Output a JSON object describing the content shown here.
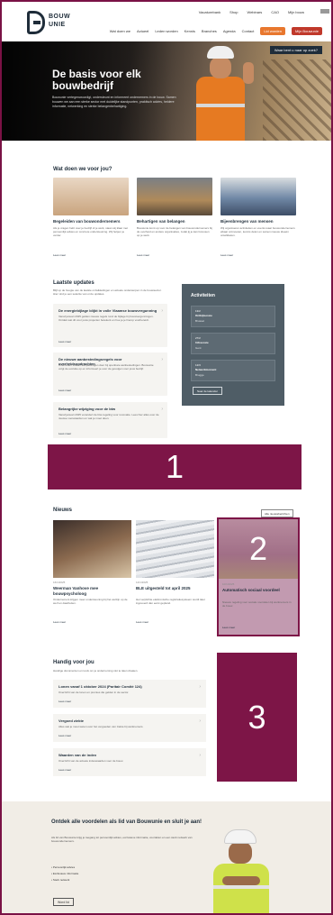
{
  "header": {
    "logo_text_1": "BOUW",
    "logo_text_2": "UNIE",
    "util_nav": [
      "Vacaturebank",
      "Shop",
      "Webinars",
      "CAO",
      "Mijn bouw"
    ],
    "main_nav": [
      "Wat doen we",
      "Actueel",
      "Leden worden",
      "Kennis",
      "Branches",
      "Agenda",
      "Contact"
    ],
    "btn_member": "Lid worden",
    "btn_login": "Mijn Bouwunie",
    "search_label": "Waar bent u naar op zoek?"
  },
  "hero": {
    "title": "De basis voor elk bouwbedrijf",
    "text": "Bouwunie vertegenwoordigt, ondersteunt en informeert ondernemers in de bouw. Samen bouwen we aan een sterke sector met duidelijke standpunten, praktisch advies, heldere informatie, netwerking en sterke belangenbehartiging."
  },
  "services": {
    "title": "Wat doen we voor jou?",
    "items": [
      {
        "title": "Begeleiden van bouwondernemers",
        "text": "Als je vragen hebt over je bedrijf of je werk, staan wij klaar met persoonlijk advies en concrete ondersteuning. Wij helpen je verder.",
        "link": "Lees meer"
      },
      {
        "title": "Behartigen van belangen",
        "text": "Bouwunie komt op voor de belangen van bouwondernemers bij de overheid en andere organisaties, zodat jij je kan focussen op je werk.",
        "link": "Lees meer"
      },
      {
        "title": "Bijeenbrengen van mensen",
        "text": "Wij organiseren activiteiten en events waar bouwondernemers elkaar ontmoeten, kennis delen en samen nieuwe ideeën ontwikkelen.",
        "link": "Lees meer"
      }
    ]
  },
  "updates": {
    "title": "Laatste updates",
    "intro": "Blijf op de hoogte van de laatste ontwikkelingen en actuele onderwerpen in de bouwsector. Hier vind je een selectie van onze updates.",
    "items": [
      {
        "title": "De energiebijlage blijkt in volle Vlaamse bouwvergunning",
        "text": "Vanaf januari 2025 gelden nieuwe regels rond de bijlage bij bouwvergunningen. Ontdek wat dit voor jouw projecten betekent en hoe je je hierop voorbereidt.",
        "link": "Lees meer"
      },
      {
        "title": "De nieuwe aanbestedingsregels voor overheidsopdrachten",
        "text": "Overheden voeren aanpassingen door bij openbare aanbestedingen. Bouwunie volgt de evolutie op en informeert je over de gevolgen voor jouw bedrijf.",
        "link": "Lees meer"
      },
      {
        "title": "Belangrijke wijziging voor de btw",
        "text": "Vanaf januari 2025 verandert de btw-regeling voor renovatie. Lees hier alles over de nieuwe voorwaarden en wat je moet doen.",
        "link": "Lees meer"
      }
    ]
  },
  "activities": {
    "title": "Activiteiten",
    "items": [
      {
        "date": "13/2",
        "name": "Ontbijtsessie",
        "sub": "Brussel"
      },
      {
        "date": "27/2",
        "name": "Infosessie",
        "sub": "Gent"
      },
      {
        "date": "12/3",
        "name": "Netwerkmoment",
        "sub": "Brugge"
      }
    ],
    "button": "Naar de kalender"
  },
  "highlight1": {
    "number": "1"
  },
  "highlight2": {
    "number": "2"
  },
  "highlight3": {
    "number": "3"
  },
  "news": {
    "title": "Nieuws",
    "all_button": "Alle nieuwsberichten",
    "items": [
      {
        "date": "16/1/2025",
        "title": "Weerman Vanhove mee bouwpsycholoog",
        "text": "Ondernemers krijgen meer ondersteuning bij het welzijn op de werf en daarbuiten.",
        "link": "Lees meer"
      },
      {
        "date": "14/1/2025",
        "title": "BLE uitgesteld tot april 2025",
        "text": "Het verplichte elektronische registratiesysteem wordt later ingevoerd dan eerst gepland.",
        "link": "Lees meer"
      },
      {
        "date": "10/1/2025",
        "title": "Automatisch sociaal voordeel",
        "text": "Nieuwe regeling voor sociale voordelen bij werknemers in de bouw.",
        "link": "Lees meer"
      }
    ]
  },
  "handy": {
    "title": "Handig voor jou",
    "intro": "Handige documenten en tools om je onderneming vlot te laten draaien.",
    "items": [
      {
        "title": "Lonen vanaf 1 oktober 2024 (Paritair Comité 124)",
        "text": "Overzicht van de lonen en premies die gelden in de sector.",
        "link": "Lees meer"
      },
      {
        "title": "Vergoed ziekte",
        "text": "Alles wat je moet weten over het vergoeden van ziekte bij werknemers.",
        "link": "Lees meer"
      },
      {
        "title": "Waarden van de index",
        "text": "Overzicht van de actuele indexwaarden voor de bouw.",
        "link": "Lees meer"
      }
    ]
  },
  "cta": {
    "title": "Ontdek alle voordelen als lid van Bouwunie en sluit je aan!",
    "text": "Als lid van Bouwunie krijg je toegang tot persoonlijk advies, exclusieve informatie, voordelen en een sterk netwerk van bouwondernemers.",
    "bullets": [
      "Persoonlijk advies",
      "Exclusieve informatie",
      "Sterk netwerk"
    ],
    "button": "Word lid"
  }
}
